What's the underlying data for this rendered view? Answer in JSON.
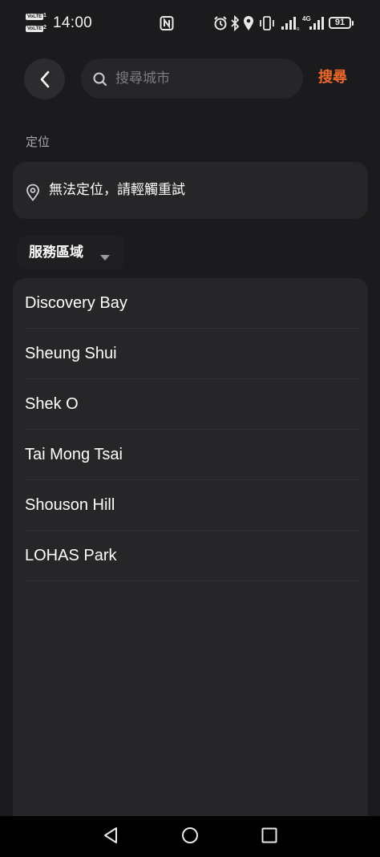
{
  "status_bar": {
    "volte_1": "VoLTE",
    "volte_1_num": "1",
    "volte_2": "VoLTE",
    "volte_2_num": "2",
    "time": "14:00",
    "network": "4G",
    "battery_level": "91",
    "icons": [
      "nfc-icon",
      "alarm-icon",
      "bluetooth-icon",
      "location-icon",
      "vibrate-icon",
      "signal-icon",
      "signal-icon",
      "battery-icon"
    ]
  },
  "header": {
    "back_icon": "chevron-left-icon",
    "search_placeholder": "搜尋城市",
    "search_value": "",
    "search_button": "搜尋"
  },
  "location": {
    "section_label": "定位",
    "icon": "map-pin-icon",
    "message": "無法定位，請輕觸重試"
  },
  "region": {
    "label": "服務區域",
    "icon": "caret-down-icon"
  },
  "areas": [
    {
      "name": "Discovery Bay"
    },
    {
      "name": "Sheung Shui"
    },
    {
      "name": "Shek O"
    },
    {
      "name": "Tai Mong Tsai"
    },
    {
      "name": "Shouson Hill"
    },
    {
      "name": "LOHAS Park"
    }
  ],
  "nav_bar": {
    "back": "triangle-back-icon",
    "home": "circle-home-icon",
    "recents": "square-recents-icon"
  },
  "colors": {
    "background": "#1b1b1d",
    "card": "#262629",
    "accent": "#f0672a",
    "muted_text": "#a9a9ad",
    "placeholder": "#7b7b80"
  }
}
